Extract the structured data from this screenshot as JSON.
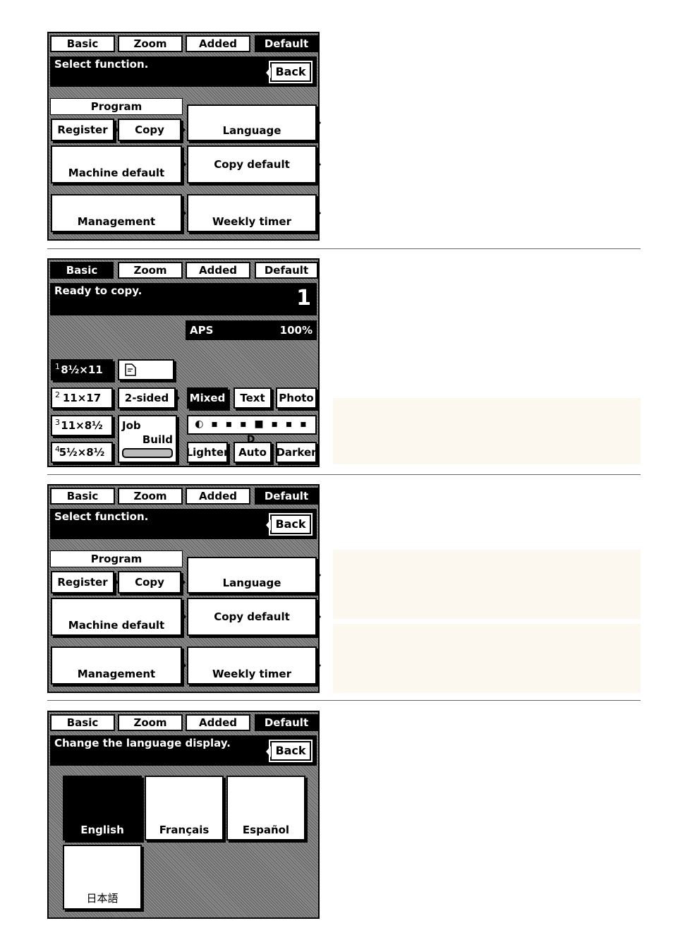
{
  "tabs": [
    "Basic",
    "Zoom",
    "Added",
    "Default"
  ],
  "default_screen": {
    "status": "Select function.",
    "back": "Back",
    "program_label": "Program",
    "register": "Register",
    "copy": "Copy",
    "language": "Language",
    "machine_default": "Machine default",
    "copy_default": "Copy default",
    "management": "Management",
    "weekly_timer": "Weekly timer"
  },
  "basic_screen": {
    "status": "Ready to copy.",
    "count": "1",
    "aps": "APS",
    "zoom": "100%",
    "paper": [
      {
        "n": "1",
        "size": "8½×11"
      },
      {
        "n": "2",
        "size": "11×17"
      },
      {
        "n": "3",
        "size": "11×8½"
      },
      {
        "n": "4",
        "size": "5½×8½"
      }
    ],
    "two_sided": "2-sided",
    "job_build_1": "Job",
    "job_build_2": "Build",
    "mixed": "Mixed",
    "text": "Text",
    "photo": "Photo",
    "exposure_scale": "◐ ▪ ▪ ▪ ■ ▪ ▪ ▪ D",
    "lighter": "Lighter",
    "auto": "Auto",
    "darker": "Darker"
  },
  "language_screen": {
    "status": "Change the language display.",
    "back": "Back",
    "english": "English",
    "french": "Français",
    "spanish": "Español",
    "japanese": "日本語"
  }
}
